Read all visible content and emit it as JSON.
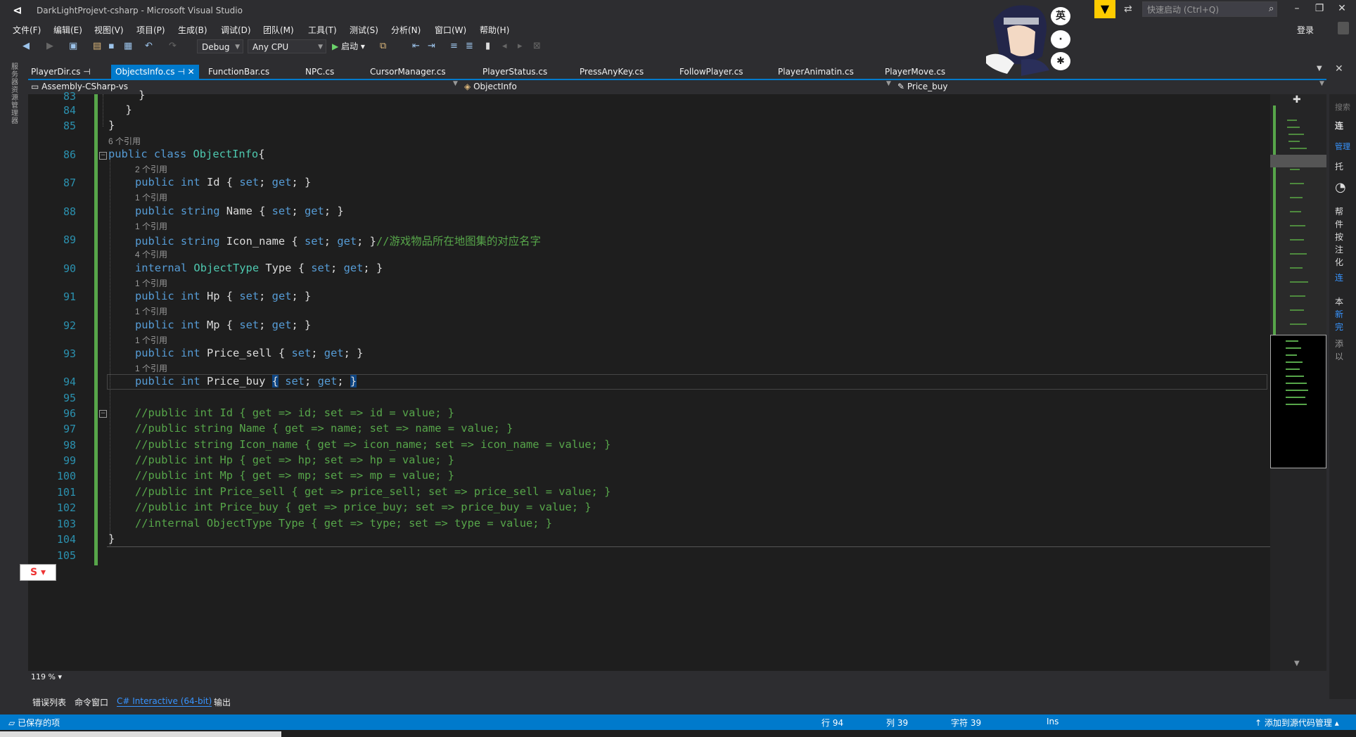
{
  "window": {
    "title": "DarkLightProjevt-csharp - Microsoft Visual Studio",
    "quick_launch_placeholder": "快速启动 (Ctrl+Q)",
    "min": "–",
    "max": "❐",
    "close": "✕"
  },
  "menu": [
    "文件(F)",
    "编辑(E)",
    "视图(V)",
    "项目(P)",
    "生成(B)",
    "调试(D)",
    "团队(M)",
    "工具(T)",
    "测试(S)",
    "分析(N)",
    "窗口(W)",
    "帮助(H)"
  ],
  "account": {
    "login": "登录"
  },
  "toolbar": {
    "config": "Debug",
    "platform": "Any CPU",
    "start": "启动"
  },
  "ime": {
    "lang": "英"
  },
  "left_rail": "服务器资源管理器",
  "tabs": [
    "PlayerDir.cs",
    "ObjectsInfo.cs",
    "FunctionBar.cs",
    "NPC.cs",
    "CursorManager.cs",
    "PlayerStatus.cs",
    "PressAnyKey.cs",
    "FollowPlayer.cs",
    "PlayerAnimatin.cs",
    "PlayerMove.cs"
  ],
  "navbar": {
    "project": "Assembly-CSharp-vs",
    "type": "ObjectInfo",
    "member": "Price_buy"
  },
  "code": {
    "lines": {
      "l83": "83",
      "l84": "84",
      "l85": "85",
      "l86": "86",
      "l87": "87",
      "l88": "88",
      "l89": "89",
      "l90": "90",
      "l91": "91",
      "l92": "92",
      "l93": "93",
      "l94": "94",
      "l95": "95",
      "l96": "96",
      "l97": "97",
      "l98": "98",
      "l99": "99",
      "l100": "100",
      "l101": "101",
      "l102": "102",
      "l103": "103",
      "l104": "104",
      "l105": "105"
    },
    "refs": {
      "r6": "6 个引用",
      "r2": "2 个引用",
      "r1": "1 个引用",
      "r4": "4 个引用"
    },
    "comment89": "//游戏物品所在地图集的对应名字",
    "c96": "//public int Id { get => id; set => id = value; }",
    "c97": "//public string Name { get => name; set => name = value; }",
    "c98": "//public string Icon_name { get => icon_name; set => icon_name = value; }",
    "c99": "//public int Hp { get => hp; set => hp = value; }",
    "c100": "//public int Mp { get => mp; set => mp = value; }",
    "c101": "//public int Price_sell { get => price_sell; set => price_sell = value; }",
    "c102": "//public int Price_buy { get => price_buy; set => price_buy = value; }",
    "c103": "//internal ObjectType Type { get => type; set => type = value; }"
  },
  "zoom": "119 %",
  "right_panel": {
    "search": "搜索",
    "connect": "连",
    "manage": "管理",
    "tuo": "托",
    "bang": "帮",
    "jian": "件",
    "an": "按",
    "zhu": "注",
    "hua": "化",
    "lian": "连",
    "ben": "本",
    "xin": "新",
    "wan": "完",
    "tian": "添",
    "yi": "以"
  },
  "bottom_tabs": [
    "错误列表",
    "命令窗口",
    "C# Interactive (64-bit)",
    "输出"
  ],
  "status": {
    "saved": "已保存的项",
    "row": "行 94",
    "col": "列 39",
    "char": "字符 39",
    "ins": "Ins",
    "source_control": "添加到源代码管理"
  },
  "colors": {
    "accent": "#007acc",
    "keyword": "#569cd6",
    "type": "#4ec9b0",
    "comment": "#57a64a",
    "linenum": "#2b91af"
  }
}
